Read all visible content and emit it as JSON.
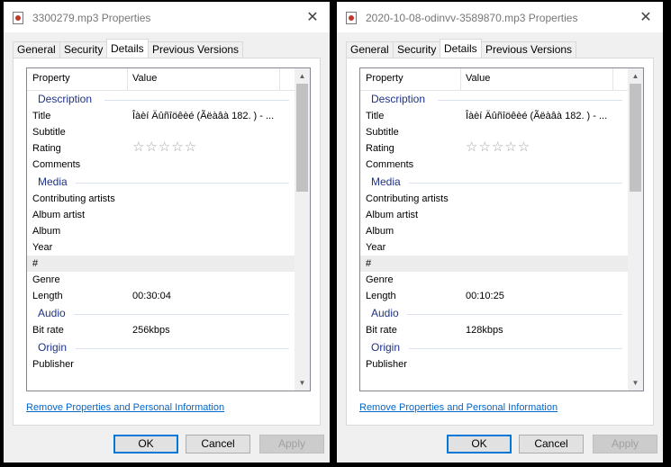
{
  "dialogs": [
    {
      "title": "3300279.mp3 Properties",
      "tabs": [
        "General",
        "Security",
        "Details",
        "Previous Versions"
      ],
      "active_tab": "Details",
      "columns": {
        "property": "Property",
        "value": "Value"
      },
      "sections": [
        {
          "label": "Description",
          "rows": [
            {
              "name": "Title",
              "value": "Îàèí Äûñîöêèé (Ãëàâà 182. ) - ..."
            },
            {
              "name": "Subtitle",
              "value": ""
            },
            {
              "name": "Rating",
              "value": "☆☆☆☆☆",
              "rating": 0
            },
            {
              "name": "Comments",
              "value": ""
            }
          ]
        },
        {
          "label": "Media",
          "rows": [
            {
              "name": "Contributing artists",
              "value": ""
            },
            {
              "name": "Album artist",
              "value": ""
            },
            {
              "name": "Album",
              "value": ""
            },
            {
              "name": "Year",
              "value": ""
            },
            {
              "name": "#",
              "value": "",
              "highlighted": true
            },
            {
              "name": "Genre",
              "value": ""
            },
            {
              "name": "Length",
              "value": "00:30:04"
            }
          ]
        },
        {
          "label": "Audio",
          "rows": [
            {
              "name": "Bit rate",
              "value": "256kbps"
            }
          ]
        },
        {
          "label": "Origin",
          "rows": [
            {
              "name": "Publisher",
              "value": ""
            }
          ]
        }
      ],
      "link": "Remove Properties and Personal Information",
      "buttons": {
        "ok": "OK",
        "cancel": "Cancel",
        "apply": "Apply"
      },
      "apply_enabled": false
    },
    {
      "title": "2020-10-08-odinvv-3589870.mp3 Properties",
      "tabs": [
        "General",
        "Security",
        "Details",
        "Previous Versions"
      ],
      "active_tab": "Details",
      "columns": {
        "property": "Property",
        "value": "Value"
      },
      "sections": [
        {
          "label": "Description",
          "rows": [
            {
              "name": "Title",
              "value": "Îàèí Äûñîöêèé (Ãëàâà 182. ) - ..."
            },
            {
              "name": "Subtitle",
              "value": ""
            },
            {
              "name": "Rating",
              "value": "☆☆☆☆☆",
              "rating": 0
            },
            {
              "name": "Comments",
              "value": ""
            }
          ]
        },
        {
          "label": "Media",
          "rows": [
            {
              "name": "Contributing artists",
              "value": ""
            },
            {
              "name": "Album artist",
              "value": ""
            },
            {
              "name": "Album",
              "value": ""
            },
            {
              "name": "Year",
              "value": ""
            },
            {
              "name": "#",
              "value": "",
              "highlighted": true
            },
            {
              "name": "Genre",
              "value": ""
            },
            {
              "name": "Length",
              "value": "00:10:25"
            }
          ]
        },
        {
          "label": "Audio",
          "rows": [
            {
              "name": "Bit rate",
              "value": "128kbps"
            }
          ]
        },
        {
          "label": "Origin",
          "rows": [
            {
              "name": "Publisher",
              "value": ""
            }
          ]
        }
      ],
      "link": "Remove Properties and Personal Information",
      "buttons": {
        "ok": "OK",
        "cancel": "Cancel",
        "apply": "Apply"
      },
      "apply_enabled": false
    }
  ],
  "colors": {
    "section_label": "#1e3287",
    "link": "#0066cc",
    "default_button_border": "#0078d7"
  }
}
